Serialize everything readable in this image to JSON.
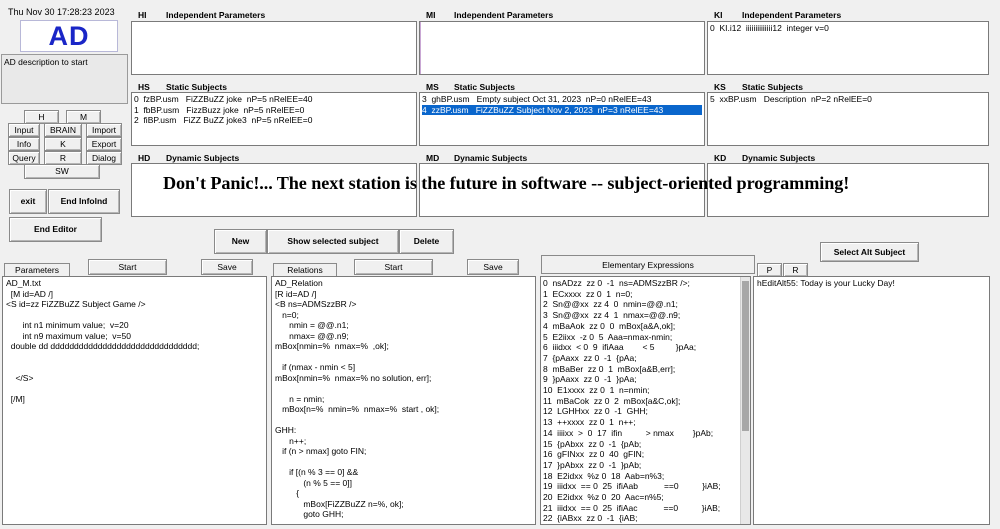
{
  "clock": "Thu Nov 30 17:28:23 2023",
  "logo": "AD",
  "description": "AD description to start",
  "left_buttons": {
    "H": "H",
    "M": "M",
    "Input": "Input",
    "BRAIN": "BRAIN",
    "Import": "Import",
    "Info": "Info",
    "K": "K",
    "Export": "Export",
    "Query": "Query",
    "R": "R",
    "Dialog": "Dialog",
    "SW": "SW",
    "exit": "exit",
    "end_infolnd": "End Infolnd",
    "end_editor": "End Editor"
  },
  "panels": {
    "HI": {
      "code": "HI",
      "title": "Independent Parameters",
      "lines": []
    },
    "MI": {
      "code": "MI",
      "title": "Independent Parameters",
      "lines": []
    },
    "KI": {
      "code": "KI",
      "title": "Independent Parameters",
      "lines": [
        "0  KI.i12  iiiiiiiiiiiiii12  integer v=0"
      ]
    },
    "HS": {
      "code": "HS",
      "title": "Static Subjects",
      "lines": [
        "0  fzBP.usm   FiZZBuZZ joke  nP=5 nRelEE=40",
        "1  fbBP.usm   FizzBuzz joke  nP=5 nRelEE=0",
        "2  fiBP.usm   FiZZ BuZZ joke3  nP=5 nRelEE=0"
      ]
    },
    "MS": {
      "code": "MS",
      "title": "Static Subjects",
      "lines": [
        "3  ghBP.usm   Empty subject Oct 31, 2023  nP=0 nRelEE=43",
        "4  zzBP.usm   FiZZBuZZ Subject Nov 2, 2023  nP=3 nRelEE=43"
      ]
    },
    "KS": {
      "code": "KS",
      "title": "Static Subjects",
      "lines": [
        "5  xxBP.usm   Description  nP=2 nRelEE=0"
      ]
    },
    "HD": {
      "code": "HD",
      "title": "Dynamic Subjects"
    },
    "MD": {
      "code": "MD",
      "title": "Dynamic Subjects"
    },
    "KD": {
      "code": "KD",
      "title": "Dynamic Subjects"
    }
  },
  "banner": "Don't Panic!... The next station is the future in software -- subject-oriented programming!",
  "center_buttons": {
    "new": "New",
    "show_selected": "Show selected subject",
    "delete": "Delete"
  },
  "select_alt": "Select Alt Subject",
  "columns": {
    "parameters": {
      "tab": "Parameters",
      "start": "Start",
      "save": "Save"
    },
    "relations": {
      "tab": "Relations",
      "start": "Start",
      "save": "Save"
    },
    "elementary": {
      "tab": "Elementary Expressions"
    },
    "alt": {
      "P": "P",
      "R": "R"
    }
  },
  "parameters_text": [
    "AD_M.txt",
    "  [M id=AD /]",
    "<S id=zz FiZZBuZZ Subject Game />",
    "",
    "       int n1 minimum value;  v=20",
    "       int n9 maximum value;  v=50",
    "  double dd ddddddddddddddddddddddddddddddd;",
    "",
    "",
    "    </S>",
    "",
    "  [/M]"
  ],
  "relations_text": [
    "AD_Relation",
    "[R id=AD /]",
    "<B ns=ADMSzzBR />",
    "   n=0;",
    "      nmin = @@.n1;",
    "      nmax= @@.n9;",
    "mBox[nmin=%  nmax=%  ,ok];",
    "",
    "   if (nmax - nmin < 5]",
    "mBox[nmin=%  nmax=% no solution, err];",
    "",
    "      n = nmin;",
    "   mBox[n=%  nmin=%  nmax=%  start , ok];",
    "",
    "GHH:",
    "      n++;",
    "   if (n > nmax] goto FIN;",
    "",
    "      if [(n % 3 == 0] &&",
    "            (n % 5 == 0]]",
    "         {",
    "            mBox[FiZZBuZZ n=%, ok];",
    "            goto GHH;"
  ],
  "elementary_text": [
    "0  nsADzz  zz 0  -1  ns=ADMSzzBR />;",
    "1  ECxxxx  zz 0  1  n=0;",
    "2  Sn@@xx  zz 4  0  nmin=@@.n1;",
    "3  Sn@@xx  zz 4  1  nmax=@@.n9;",
    "4  mBaAok  zz 0  0  mBox[a&A,ok];",
    "5  E2iixx  -z 0  5  Aaa=nmax-nmin;",
    "6  iiidxx  < 0  9  ifiAaa        < 5         }pAa;",
    "7  {pAaxx  zz 0  -1  {pAa;",
    "8  mBaBer  zz 0  1  mBox[a&B,err];",
    "9  }pAaxx  zz 0  -1  }pAa;",
    "10  E1xxxx  zz 0  1  n=nmin;",
    "11  mBaCok  zz 0  2  mBox[a&C,ok];",
    "12  LGHHxx  zz 0  -1  GHH;",
    "13  ++xxxx  zz 0  1  n++;",
    "14  iiiixx  >  0  17  ifin          > nmax        }pAb;",
    "15  {pAbxx  zz 0  -1  {pAb;",
    "16  gFINxx  zz 0  40  gFIN;",
    "17  }pAbxx  zz 0  -1  }pAb;",
    "18  E2idxx  %z 0  18  Aab=n%3;",
    "19  iiidxx  == 0  25  ifiAab           ==0          }iAB;",
    "20  E2idxx  %z 0  20  Aac=n%5;",
    "21  iiidxx  == 0  25  ifiAac           ==0          }iAB;",
    "22  {iABxx  zz 0  -1  {iAB;"
  ],
  "alt_text": "hEditAlt55: Today is your Lucky Day!"
}
